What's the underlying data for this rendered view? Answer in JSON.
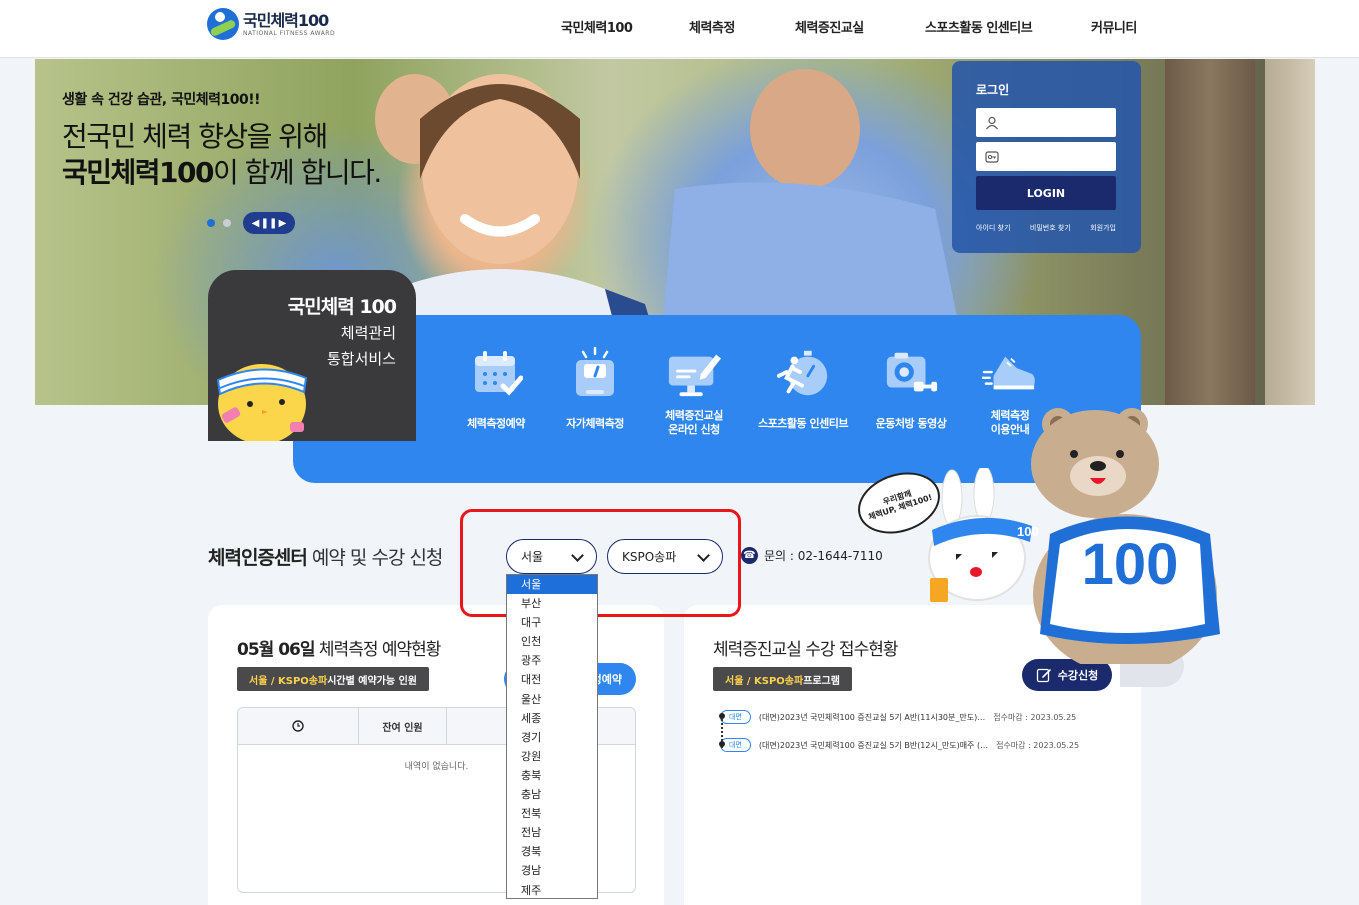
{
  "header": {
    "logo_title": "국민체력100",
    "logo_sub": "NATIONAL FITNESS AWARD",
    "nav": [
      "국민체력100",
      "체력측정",
      "체력증진교실",
      "스포츠활동 인센티브",
      "커뮤니티"
    ]
  },
  "hero": {
    "sub": "생활 속 건강 습관, 국민체력100!!",
    "line1": "전국민 체력 향상을 위해",
    "line2_bold": "국민체력100",
    "line2_rest": "이 함께 합니다.",
    "ctrl": [
      "◀",
      "❚❚",
      "▶"
    ]
  },
  "login": {
    "title": "로그인",
    "id_icon": "user-icon",
    "pw_icon": "key-icon",
    "button": "LOGIN",
    "links": [
      "아이디 찾기",
      "비밀번호 찾기",
      "회원가입"
    ]
  },
  "intro_card": {
    "title": "국민체력 100",
    "line1": "체력관리",
    "line2": "통합서비스"
  },
  "services": [
    {
      "label": "체력측정예약",
      "icon": "calendar-check-icon"
    },
    {
      "label": "자가체력측정",
      "icon": "scale-icon"
    },
    {
      "label": "체력증진교실\n온라인 신청",
      "icon": "monitor-pen-icon"
    },
    {
      "label": "스포츠활동 인센티브",
      "icon": "runner-stopwatch-icon"
    },
    {
      "label": "운동처방 동영상",
      "icon": "camera-icon"
    },
    {
      "label": "체력측정\n이용안내",
      "icon": "sneaker-icon"
    }
  ],
  "section": {
    "title_bold": "체력인증센터",
    "title_rest": " 예약 및 수강 신청",
    "region_select": "서울",
    "center_select": "KSPO송파",
    "phone": "문의 : 02-1644-7110"
  },
  "region_options": [
    "서울",
    "부산",
    "대구",
    "인천",
    "광주",
    "대전",
    "울산",
    "세종",
    "경기",
    "강원",
    "충북",
    "충남",
    "전북",
    "전남",
    "경북",
    "경남",
    "제주"
  ],
  "left_card": {
    "date": "05월 06일",
    "title_rest": " 체력측정 예약현황",
    "tag_em": "서울 / KSPO송파",
    "tag_rest": " 시간별 예약가능 인원",
    "button": "측정예약",
    "col_time_icon": "clock-icon",
    "col_remaining": "잔여 인원",
    "empty": "내역이 없습니다."
  },
  "right_card": {
    "title": "체력증진교실 수강 접수현황",
    "tag_em": "서울 / KSPO송파",
    "tag_rest": " 프로그램",
    "button": "수강신청",
    "programs": [
      {
        "badge": "대면",
        "text": "(대면)2023년 국민체력100 증진교실 5기 A반(11시30분_만도)…",
        "deadline": "접수마감 : 2023.05.25"
      },
      {
        "badge": "대면",
        "text": "(대면)2023년 국민체력100 증진교실 5기 B반(12시_만도)매주 (…",
        "deadline": "접수마감 : 2023.05.25"
      }
    ]
  },
  "mascot": {
    "bubble": "우리함께\n체력UP, 체력100!",
    "shirt": "100",
    "band": "100"
  },
  "colors": {
    "brand_blue": "#2f86ee",
    "navy": "#1a2a6c",
    "highlight_red": "#e8161b"
  }
}
